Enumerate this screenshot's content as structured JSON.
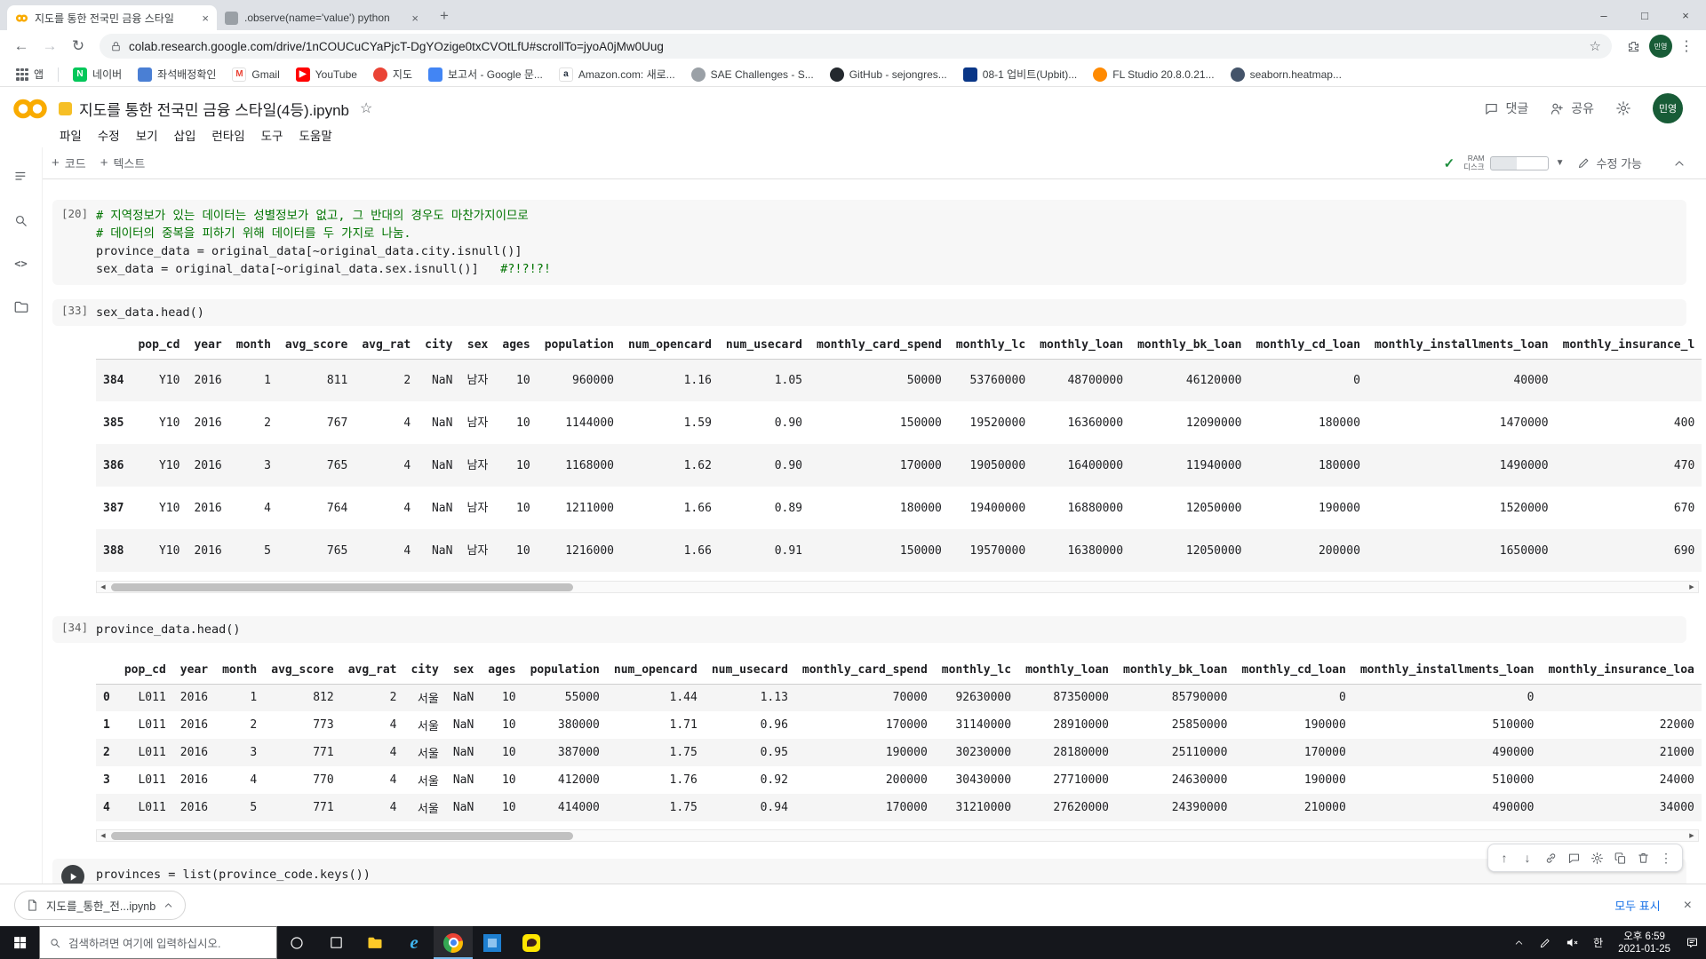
{
  "colors": {
    "accent_blue": "#1a73e8",
    "comment_green": "#007400",
    "colab_logo": "#f9ab00",
    "avatar_green": "#185c37",
    "check_green": "#1e8e3e",
    "taskbar_bg": "#15171c",
    "chrome_underline": "#76b9ed",
    "kakao_yellow": "#fee500",
    "tabstrip_bg": "#dee1e6",
    "omnibox_bg": "#f1f3f4",
    "code_bg": "#f7f7f7",
    "row_stripe": "#f5f5f5"
  },
  "icons": [
    "colab-logo-icon",
    "lock-icon",
    "star-icon",
    "extensions-icon",
    "back-icon",
    "forward-icon",
    "reload-icon",
    "menu-dots-icon",
    "comment-icon",
    "share-icon",
    "settings-gear-icon",
    "pencil-icon",
    "toc-icon",
    "search-icon",
    "code-icon",
    "folder-icon",
    "move-up-icon",
    "move-down-icon",
    "link-icon",
    "gear-icon",
    "copy-icon",
    "trash-icon",
    "more-vert-icon",
    "file-icon",
    "chevron-up-icon",
    "windows-start-icon",
    "cortana-icon",
    "task-view-icon",
    "speaker-mute-icon",
    "pen-icon",
    "notification-icon"
  ],
  "browser": {
    "tabs": [
      {
        "title": "지도를 통한 전국민 금융 스타일",
        "active": true
      },
      {
        "title": ".observe(name='value') python",
        "active": false
      }
    ],
    "url": "colab.research.google.com/drive/1nCOUCuCYaPjcT-DgYOzige0txCVOtLfU#scrollTo=jyoA0jMw0Uug",
    "profile_name": "민영",
    "window_controls": {
      "minimize": "–",
      "maximize": "□",
      "close": "×"
    },
    "bookmarks": [
      {
        "label": "앱",
        "icon": "apps-grid-icon",
        "bg": "#5f6368",
        "glyph": "",
        "shape": "grid"
      },
      {
        "label": "네이버",
        "icon": "naver-icon",
        "bg": "#03c75a",
        "glyph": "N",
        "shape": "square"
      },
      {
        "label": "좌석배정확인",
        "icon": "seat-check-icon",
        "bg": "#4a7fd4",
        "glyph": "",
        "shape": "square"
      },
      {
        "label": "Gmail",
        "icon": "gmail-icon",
        "bg": "#ffffff",
        "fg": "#ea4335",
        "glyph": "M",
        "shape": "letter"
      },
      {
        "label": "YouTube",
        "icon": "youtube-icon",
        "bg": "#ff0000",
        "glyph": "▶",
        "shape": "square"
      },
      {
        "label": "지도",
        "icon": "map-pin-icon",
        "bg": "#ea4335",
        "glyph": "",
        "shape": "circle"
      },
      {
        "label": "보고서 - Google 문...",
        "icon": "google-docs-icon",
        "bg": "#4285f4",
        "glyph": "",
        "shape": "square"
      },
      {
        "label": "Amazon.com: 새로...",
        "icon": "amazon-icon",
        "bg": "#ffffff",
        "fg": "#232f3e",
        "glyph": "a",
        "shape": "letter"
      },
      {
        "label": "SAE Challenges - S...",
        "icon": "sae-icon",
        "bg": "#9aa0a6",
        "glyph": "",
        "shape": "circle"
      },
      {
        "label": "GitHub - sejongres...",
        "icon": "github-icon",
        "bg": "#24292e",
        "glyph": "",
        "shape": "circle"
      },
      {
        "label": "08-1 업비트(Upbit)...",
        "icon": "upbit-icon",
        "bg": "#093687",
        "glyph": "",
        "shape": "square"
      },
      {
        "label": "FL Studio 20.8.0.21...",
        "icon": "fl-studio-icon",
        "bg": "#ff8a00",
        "glyph": "",
        "shape": "circle"
      },
      {
        "label": "seaborn.heatmap...",
        "icon": "seaborn-icon",
        "bg": "#44546a",
        "glyph": "",
        "shape": "circle"
      }
    ]
  },
  "colab": {
    "title": "지도를 통한 전국민 금융 스타일(4등).ipynb",
    "star": "☆",
    "menus": [
      "파일",
      "수정",
      "보기",
      "삽입",
      "런타임",
      "도구",
      "도움말"
    ],
    "comment_label": "댓글",
    "share_label": "공유",
    "avatar_text": "민영",
    "add_code": "코드",
    "add_text": "텍스트",
    "ram_label": "RAM",
    "disk_label": "디스크",
    "edit_mode_label": "수정 가능"
  },
  "cells": [
    {
      "exec": "[20]",
      "lines": [
        [
          {
            "t": "c",
            "s": "# 지역정보가 있는 데이터는 성별정보가 없고, 그 반대의 경우도 마찬가지이므로"
          }
        ],
        [
          {
            "t": "c",
            "s": "# 데이터의 중복을 피하기 위해 데이터를 두 가지로 나눔."
          }
        ],
        [
          {
            "t": "p",
            "s": "province_data = original_data[~original_data.city.isnull()]"
          }
        ],
        [
          {
            "t": "p",
            "s": "sex_data = original_data[~original_data.sex.isnull()]   "
          },
          {
            "t": "c",
            "s": "#?!?!?!"
          }
        ]
      ]
    },
    {
      "exec": "[33]",
      "lines": [
        [
          {
            "t": "p",
            "s": "sex_data.head()"
          }
        ]
      ]
    },
    {
      "exec": "[34]",
      "lines": [
        [
          {
            "t": "p",
            "s": "province_data.head()"
          }
        ]
      ]
    },
    {
      "exec": "",
      "run_button": true,
      "lines": [
        [
          {
            "t": "p",
            "s": "provinces = list(province_code.keys())"
          }
        ]
      ]
    }
  ],
  "sex_table": {
    "columns": [
      "pop_cd",
      "year",
      "month",
      "avg_score",
      "avg_rat",
      "city",
      "sex",
      "ages",
      "population",
      "num_opencard",
      "num_usecard",
      "monthly_card_spend",
      "monthly_lc",
      "monthly_loan",
      "monthly_bk_loan",
      "monthly_cd_loan",
      "monthly_installments_loan",
      "monthly_insurance_l"
    ],
    "rows": [
      [
        "384",
        "Y10",
        "2016",
        "1",
        "811",
        "2",
        "NaN",
        "남자",
        "10",
        "960000",
        "1.16",
        "1.05",
        "50000",
        "53760000",
        "48700000",
        "46120000",
        "0",
        "40000",
        ""
      ],
      [
        "385",
        "Y10",
        "2016",
        "2",
        "767",
        "4",
        "NaN",
        "남자",
        "10",
        "1144000",
        "1.59",
        "0.90",
        "150000",
        "19520000",
        "16360000",
        "12090000",
        "180000",
        "1470000",
        "400"
      ],
      [
        "386",
        "Y10",
        "2016",
        "3",
        "765",
        "4",
        "NaN",
        "남자",
        "10",
        "1168000",
        "1.62",
        "0.90",
        "170000",
        "19050000",
        "16400000",
        "11940000",
        "180000",
        "1490000",
        "470"
      ],
      [
        "387",
        "Y10",
        "2016",
        "4",
        "764",
        "4",
        "NaN",
        "남자",
        "10",
        "1211000",
        "1.66",
        "0.89",
        "180000",
        "19400000",
        "16880000",
        "12050000",
        "190000",
        "1520000",
        "670"
      ],
      [
        "388",
        "Y10",
        "2016",
        "5",
        "765",
        "4",
        "NaN",
        "남자",
        "10",
        "1216000",
        "1.66",
        "0.91",
        "150000",
        "19570000",
        "16380000",
        "12050000",
        "200000",
        "1650000",
        "690"
      ]
    ]
  },
  "province_table": {
    "columns": [
      "pop_cd",
      "year",
      "month",
      "avg_score",
      "avg_rat",
      "city",
      "sex",
      "ages",
      "population",
      "num_opencard",
      "num_usecard",
      "monthly_card_spend",
      "monthly_lc",
      "monthly_loan",
      "monthly_bk_loan",
      "monthly_cd_loan",
      "monthly_installments_loan",
      "monthly_insurance_loa"
    ],
    "rows": [
      [
        "0",
        "L011",
        "2016",
        "1",
        "812",
        "2",
        "서울",
        "NaN",
        "10",
        "55000",
        "1.44",
        "1.13",
        "70000",
        "92630000",
        "87350000",
        "85790000",
        "0",
        "0",
        ""
      ],
      [
        "1",
        "L011",
        "2016",
        "2",
        "773",
        "4",
        "서울",
        "NaN",
        "10",
        "380000",
        "1.71",
        "0.96",
        "170000",
        "31140000",
        "28910000",
        "25850000",
        "190000",
        "510000",
        "22000"
      ],
      [
        "2",
        "L011",
        "2016",
        "3",
        "771",
        "4",
        "서울",
        "NaN",
        "10",
        "387000",
        "1.75",
        "0.95",
        "190000",
        "30230000",
        "28180000",
        "25110000",
        "170000",
        "490000",
        "21000"
      ],
      [
        "3",
        "L011",
        "2016",
        "4",
        "770",
        "4",
        "서울",
        "NaN",
        "10",
        "412000",
        "1.76",
        "0.92",
        "200000",
        "30430000",
        "27710000",
        "24630000",
        "190000",
        "510000",
        "24000"
      ],
      [
        "4",
        "L011",
        "2016",
        "5",
        "771",
        "4",
        "서울",
        "NaN",
        "10",
        "414000",
        "1.75",
        "0.94",
        "170000",
        "31210000",
        "27620000",
        "24390000",
        "210000",
        "490000",
        "34000"
      ]
    ]
  },
  "download_shelf": {
    "filename": "지도를_통한_전...ipynb",
    "show_all_label": "모두 표시"
  },
  "taskbar": {
    "search_placeholder": "검색하려면 여기에 입력하십시오.",
    "ime_label": "한",
    "time": "오후 6:59",
    "date": "2021-01-25"
  }
}
